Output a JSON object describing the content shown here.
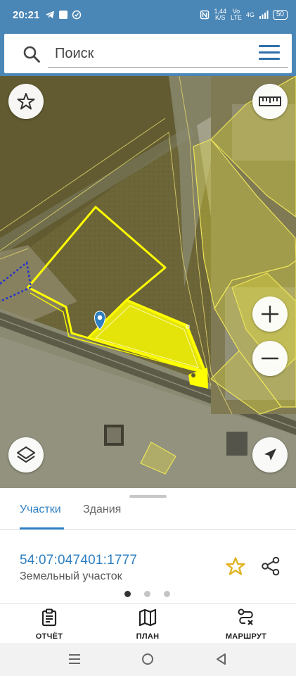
{
  "status_bar": {
    "time": "20:21",
    "net_speed_top": "1,44",
    "net_speed_bottom": "K/S",
    "volte_top": "Vo",
    "volte_bottom": "LTE",
    "network": "4G",
    "battery": "50"
  },
  "search": {
    "placeholder": "Поиск"
  },
  "map": {
    "parcel_highlight_color": "#ffff00",
    "marker_color": "#2e7fc0"
  },
  "sheet": {
    "tabs": [
      {
        "label": "Участки",
        "active": true
      },
      {
        "label": "Здания",
        "active": false
      }
    ],
    "cadastral_number": "54:07:047401:1777",
    "object_type": "Земельный участок",
    "page_count": 3,
    "current_page": 1
  },
  "actions": [
    {
      "label": "ОТЧЁТ",
      "icon": "report-icon"
    },
    {
      "label": "ПЛАН",
      "icon": "map-plan-icon"
    },
    {
      "label": "МАРШРУТ",
      "icon": "route-icon"
    }
  ],
  "colors": {
    "accent": "#2f7fc1",
    "header": "#4a86b6",
    "favorite": "#e3b422"
  }
}
